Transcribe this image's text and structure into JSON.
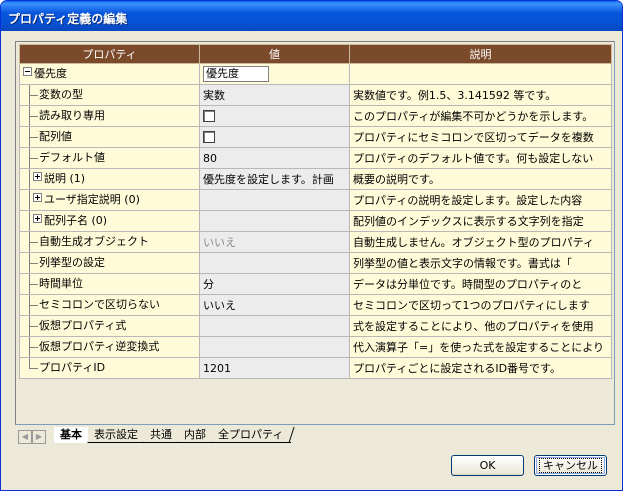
{
  "window": {
    "title": "プロパティ定義の編集"
  },
  "grid": {
    "headers": [
      "プロパティ",
      "値",
      "説明"
    ],
    "rows": [
      {
        "name": "優先度",
        "value": "優先度",
        "desc": ""
      },
      {
        "name": "変数の型",
        "value": "実数",
        "desc": "実数値です。例1.5、3.141592 等です。"
      },
      {
        "name": "読み取り専用",
        "value": "",
        "desc": "このプロパティが編集不可かどうかを示します。"
      },
      {
        "name": "配列値",
        "value": "",
        "desc": "プロパティにセミコロンで区切ってデータを複数"
      },
      {
        "name": "デフォルト値",
        "value": "80",
        "desc": "プロパティのデフォルト値です。何も設定しない"
      },
      {
        "name": "説明 (1)",
        "value": "優先度を設定します。計画",
        "desc": "概要の説明です。"
      },
      {
        "name": "ユーザ指定説明 (0)",
        "value": "",
        "desc": "プロパティの説明を設定します。設定した内容"
      },
      {
        "name": "配列子名 (0)",
        "value": "",
        "desc": "配列値のインデックスに表示する文字列を指定"
      },
      {
        "name": "自動生成オブジェクト",
        "value": "いいえ",
        "desc": "自動生成しません。オブジェクト型のプロパティ"
      },
      {
        "name": "列挙型の設定",
        "value": "",
        "desc": "列挙型の値と表示文字の情報です。書式は「"
      },
      {
        "name": "時間単位",
        "value": "分",
        "desc": "データは分単位です。時間型のプロパティのと"
      },
      {
        "name": "セミコロンで区切らない",
        "value": "いいえ",
        "desc": "セミコロンで区切って1つのプロパティにします"
      },
      {
        "name": "仮想プロパティ式",
        "value": "",
        "desc": "式を設定することにより、他のプロパティを使用"
      },
      {
        "name": "仮想プロパティ逆変換式",
        "value": "",
        "desc": "代入演算子「=」を使った式を設定することにより"
      },
      {
        "name": "プロパティID",
        "value": "1201",
        "desc": "プロパティごとに設定されるID番号です。"
      }
    ]
  },
  "tabs": [
    "基本",
    "表示設定",
    "共通",
    "内部",
    "全プロパティ"
  ],
  "buttons": {
    "ok": "OK",
    "cancel": "キャンセル"
  },
  "colors": {
    "header_bg": "#7b4a2a",
    "row_bg": "#fffbd8",
    "titlebar": "#0a5fe8"
  }
}
